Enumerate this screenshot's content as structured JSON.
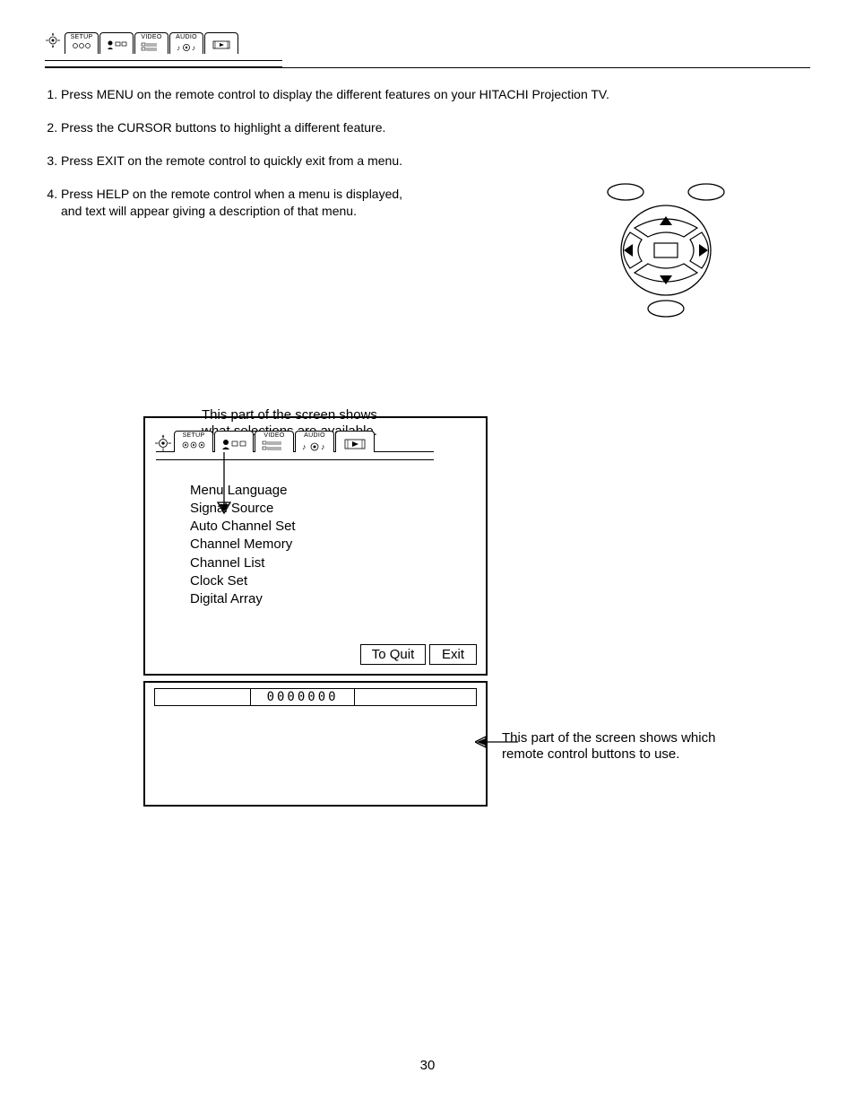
{
  "top_tabs": {
    "setup": "SETUP",
    "video": "VIDEO",
    "audio": "AUDIO"
  },
  "steps": {
    "s1": "Press MENU on the remote control to display the different features on your HITACHI Projection TV.",
    "s2": "Press the CURSOR buttons to highlight a different feature.",
    "s3": "Press EXIT on the remote control to quickly exit from a menu.",
    "s4a": "Press HELP on the remote control when a menu is displayed,",
    "s4b": "and text will appear giving a description of that menu."
  },
  "annot": {
    "top1": "This part of the screen shows",
    "top2": "what selections are available.",
    "right1": "This part of the screen shows which",
    "right2": "remote control buttons to use."
  },
  "inner_tabs": {
    "setup": "SETUP",
    "video": "VIDEO",
    "audio": "AUDIO"
  },
  "menu_items": [
    "Menu Language",
    "Signal Source",
    "Auto Channel Set",
    "Channel Memory",
    "Channel List",
    "Clock Set",
    "Digital Array"
  ],
  "menu_list_text": "Menu Language\nSignal Source\nAuto Channel Set\nChannel Memory\nChannel List\nClock Set\nDigital Array",
  "footer": {
    "to_quit": "To Quit",
    "exit": "Exit"
  },
  "channel_strip": "0000000",
  "page_number": "30"
}
